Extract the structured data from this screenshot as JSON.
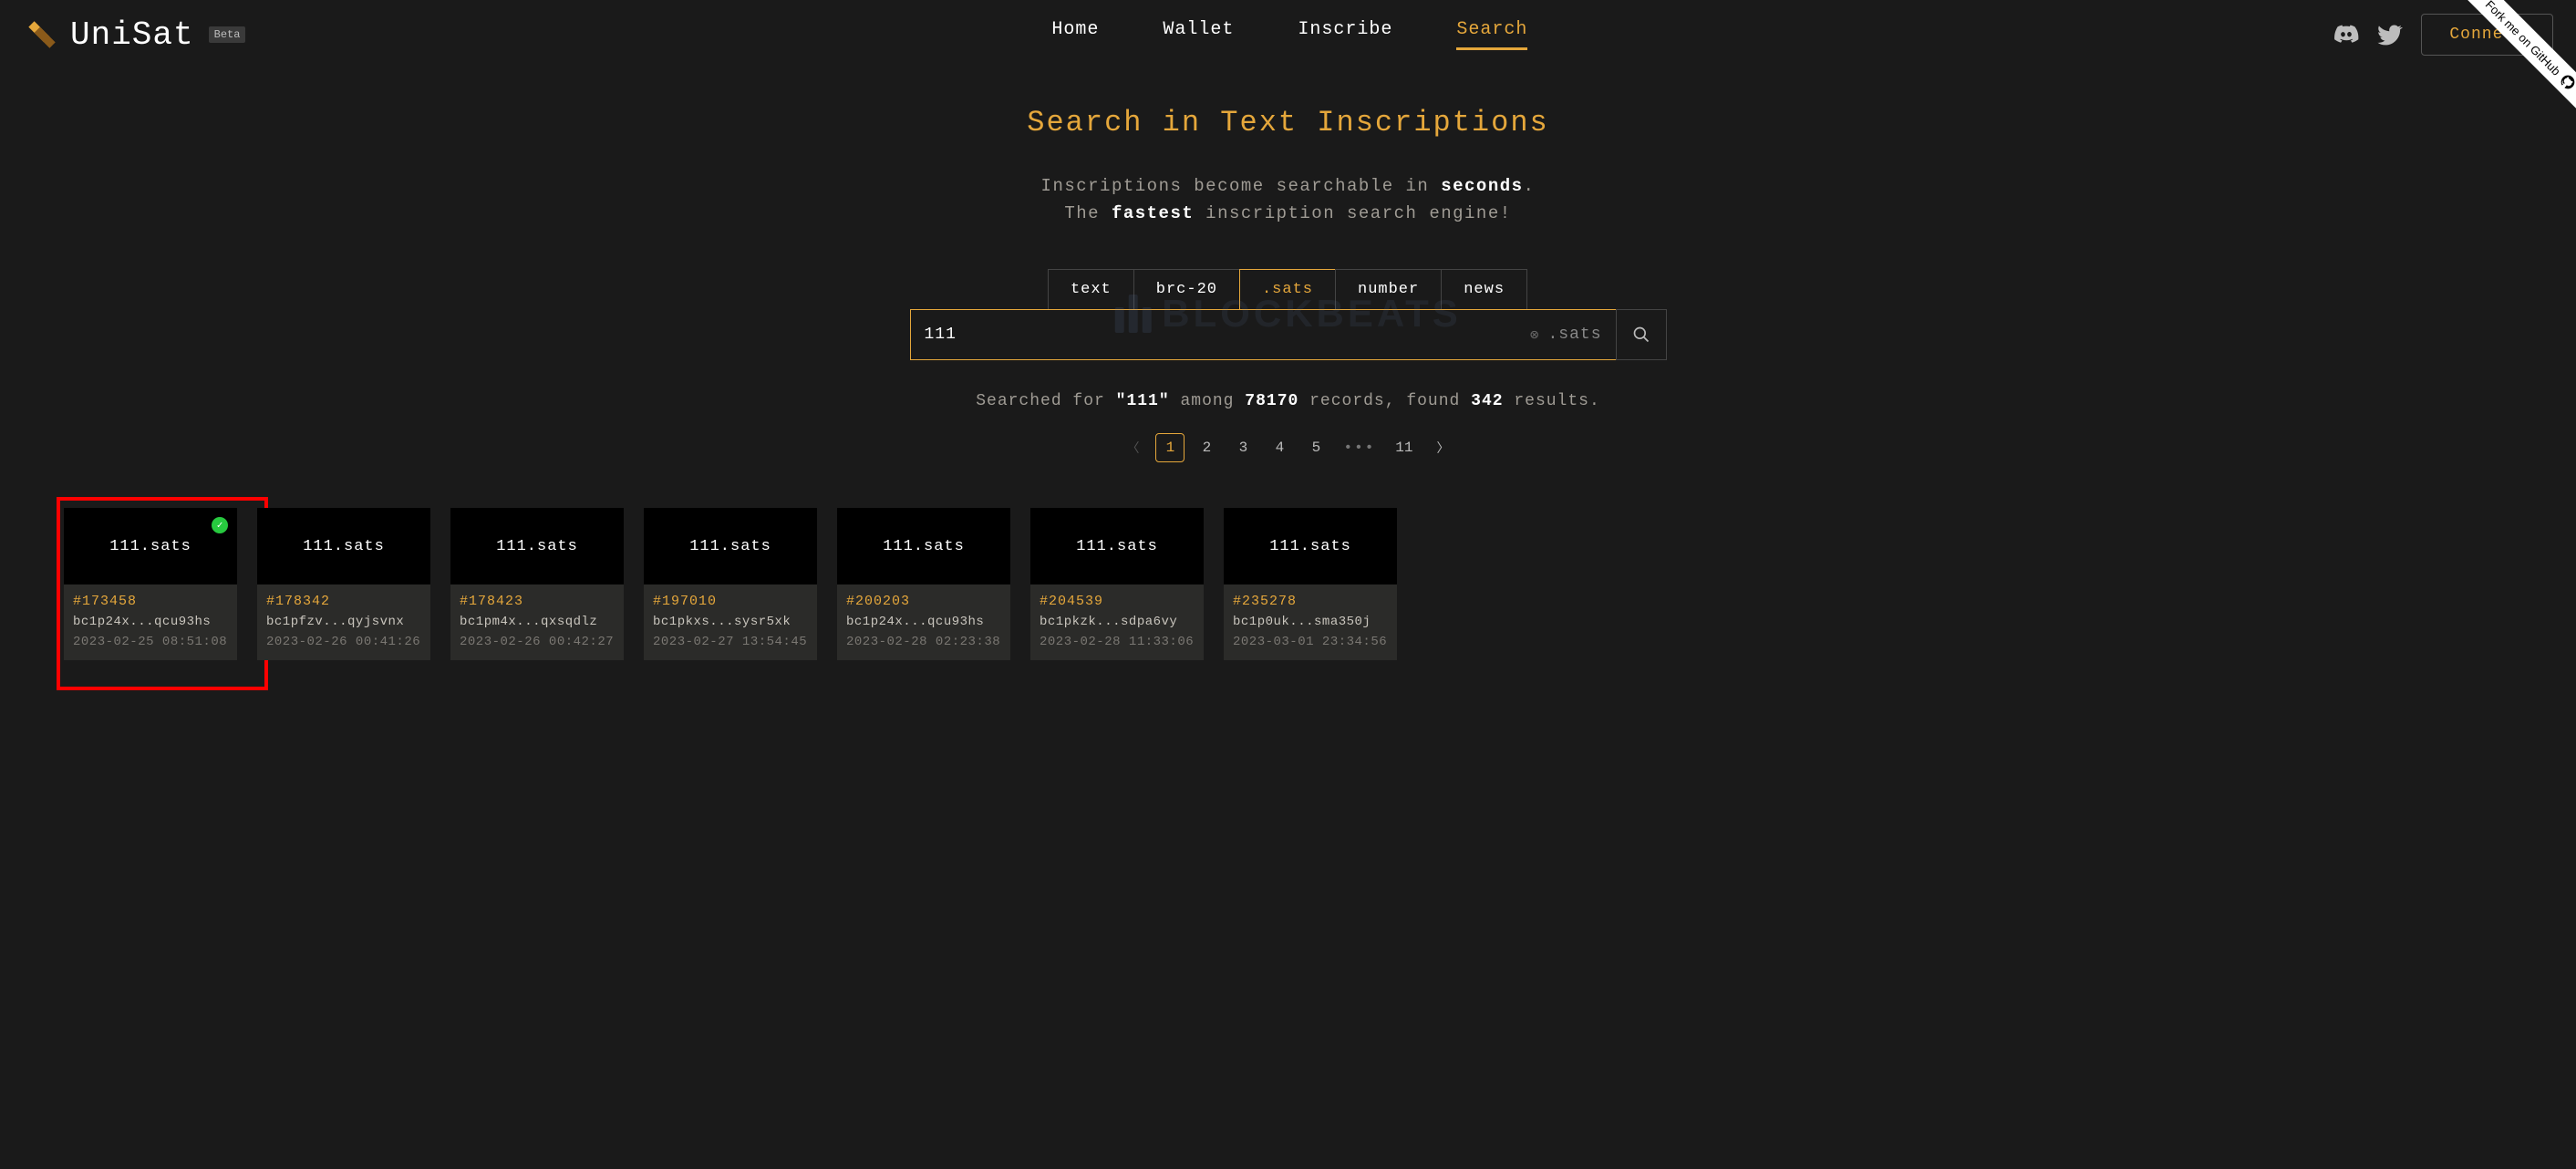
{
  "brand": "UniSat",
  "badge": "Beta",
  "nav": {
    "items": [
      "Home",
      "Wallet",
      "Inscribe",
      "Search"
    ],
    "active": "Search"
  },
  "connect_label": "Connect",
  "fork_label": "Fork me on GitHub",
  "title": "Search in Text Inscriptions",
  "sub1_a": "Inscriptions become searchable in ",
  "sub1_b": "seconds",
  "sub1_c": ".",
  "sub2_a": "The ",
  "sub2_b": "fastest",
  "sub2_c": " inscription search engine!",
  "tabs": {
    "items": [
      "text",
      "brc-20",
      ".sats",
      "number",
      "news"
    ],
    "active": ".sats"
  },
  "search": {
    "value": "111",
    "suffix": ".sats"
  },
  "result": {
    "prefix": "Searched for ",
    "term": "\"111\"",
    "mid1": " among ",
    "total": "78170",
    "mid2": " records, found ",
    "found": "342",
    "tail": " results."
  },
  "pagination": {
    "pages": [
      "1",
      "2",
      "3",
      "4",
      "5"
    ],
    "last": "11",
    "active": "1"
  },
  "cards": [
    {
      "name": "111.sats",
      "id": "#173458",
      "addr": "bc1p24x...qcu93hs",
      "time": "2023-02-25 08:51:08",
      "verified": true
    },
    {
      "name": "111.sats",
      "id": "#178342",
      "addr": "bc1pfzv...qyjsvnx",
      "time": "2023-02-26 00:41:26",
      "verified": false
    },
    {
      "name": "111.sats",
      "id": "#178423",
      "addr": "bc1pm4x...qxsqdlz",
      "time": "2023-02-26 00:42:27",
      "verified": false
    },
    {
      "name": "111.sats",
      "id": "#197010",
      "addr": "bc1pkxs...sysr5xk",
      "time": "2023-02-27 13:54:45",
      "verified": false
    },
    {
      "name": "111.sats",
      "id": "#200203",
      "addr": "bc1p24x...qcu93hs",
      "time": "2023-02-28 02:23:38",
      "verified": false
    },
    {
      "name": "111.sats",
      "id": "#204539",
      "addr": "bc1pkzk...sdpa6vy",
      "time": "2023-02-28 11:33:06",
      "verified": false
    },
    {
      "name": "111.sats",
      "id": "#235278",
      "addr": "bc1p0uk...sma350j",
      "time": "2023-03-01 23:34:56",
      "verified": false
    }
  ],
  "watermark": "BLOCKBEATS"
}
